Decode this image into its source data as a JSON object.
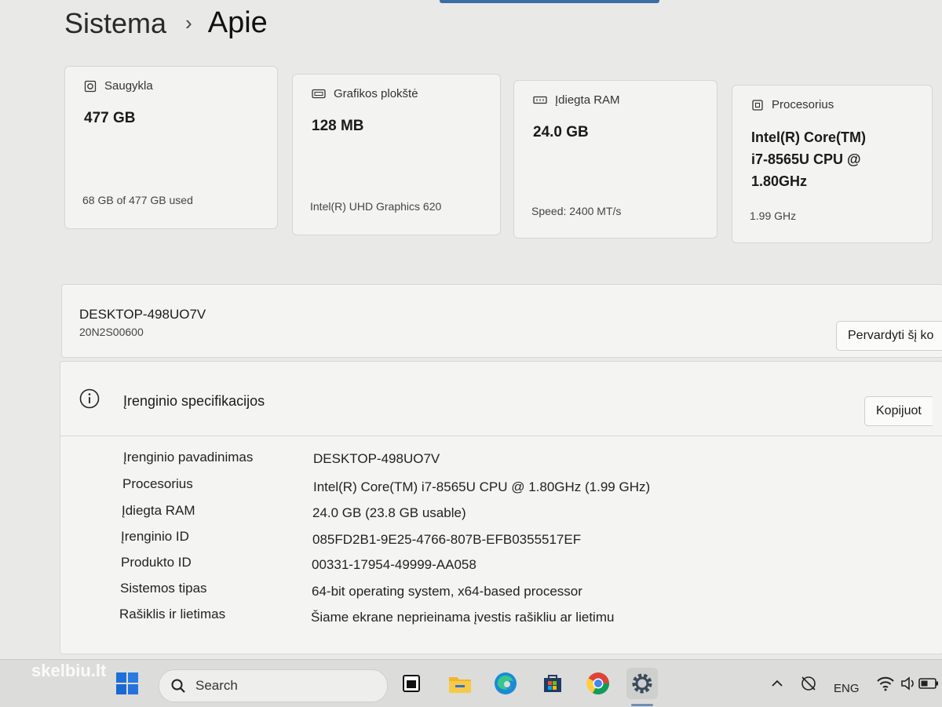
{
  "breadcrumb": {
    "parent": "Sistema",
    "separator": "›",
    "current": "Apie"
  },
  "cards": [
    {
      "title": "Saugykla",
      "value": "477 GB",
      "detail": "68 GB of 477 GB used"
    },
    {
      "title": "Grafikos plokštė",
      "value": "128 MB",
      "detail": "Intel(R) UHD Graphics 620"
    },
    {
      "title": "Įdiegta RAM",
      "value": "24.0 GB",
      "detail": "Speed: 2400 MT/s"
    },
    {
      "title": "Procesorius",
      "value_lines": [
        "Intel(R) Core(TM)",
        "i7-8565U CPU @",
        "1.80GHz"
      ],
      "detail": "1.99 GHz"
    }
  ],
  "device": {
    "name": "DESKTOP-498UO7V",
    "model": "20N2S00600",
    "rename_button": "Pervardyti šį ko"
  },
  "specs": {
    "title": "Įrenginio specifikacijos",
    "copy_button": "Kopijuot",
    "rows": [
      {
        "label": "Įrenginio pavadinimas",
        "value": "DESKTOP-498UO7V"
      },
      {
        "label": "Procesorius",
        "value": "Intel(R) Core(TM) i7-8565U CPU @ 1.80GHz (1.99 GHz)"
      },
      {
        "label": "Įdiegta RAM",
        "value": "24.0 GB (23.8 GB usable)"
      },
      {
        "label": "Įrenginio ID",
        "value": "085FD2B1-9E25-4766-807B-EFB0355517EF"
      },
      {
        "label": "Produkto ID",
        "value": "00331-17954-49999-AA058"
      },
      {
        "label": "Sistemos tipas",
        "value": "64-bit operating system, x64-based processor"
      },
      {
        "label": "Rašiklis ir lietimas",
        "value": "Šiame ekrane neprieinama įvestis rašikliu ar lietimu"
      }
    ]
  },
  "taskbar": {
    "search_label": "Search",
    "language": "ENG",
    "icons": [
      "windows-start-icon",
      "search-icon",
      "task-view-icon",
      "file-explorer-icon",
      "edge-icon",
      "store-icon",
      "chrome-icon",
      "settings-icon",
      "chevron-up-icon",
      "no-network-icon",
      "wifi-icon",
      "volume-icon",
      "battery-icon"
    ]
  },
  "watermark": "skelbiu.lt",
  "colors": {
    "accent": "#3a6ea5",
    "card_bg": "#f3f3f2",
    "page_bg": "#e9e9e8"
  }
}
